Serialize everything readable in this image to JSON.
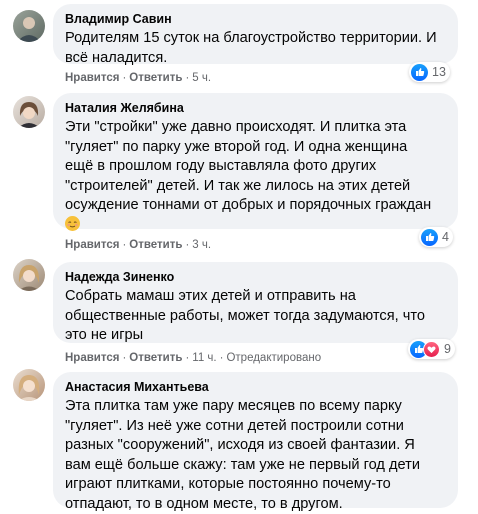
{
  "comments": [
    {
      "author": "Владимир Савин",
      "lines": [
        "Родителям 15 суток на благоустройство территории. И",
        "всё наладится."
      ],
      "like": "Нравится",
      "reply": "Ответить",
      "time": "5 ч.",
      "reaction_count": "13"
    },
    {
      "author": "Наталия Желябина",
      "lines": [
        "Эти \"стройки\" уже давно происходят. И плитка эта",
        "\"гуляет\" по парку уже второй год. И одна женщина",
        "ещё в прошлом году выставляла фото других",
        "\"строителей\" детей. И так же лилось на этих детей",
        "осуждение тоннами от добрых и порядочных граждан"
      ],
      "emoji": "relieved-face",
      "like": "Нравится",
      "reply": "Ответить",
      "time": "3 ч.",
      "reaction_count": "4"
    },
    {
      "author": "Надежда Зиненко",
      "lines": [
        "Собрать мамаш этих детей и отправить на",
        "общественные работы, может тогда задумаются, что",
        "это не игры"
      ],
      "like": "Нравится",
      "reply": "Ответить",
      "time": "11 ч.",
      "edited": "Отредактировано",
      "reaction_count": "9"
    },
    {
      "author": "Анастасия Михантьева",
      "lines": [
        "Эта плитка там уже пару месяцев по всему парку",
        "\"гуляет\". Из неё уже сотни детей построили сотни",
        "разных \"сооружений\", исходя из своей фантазии. Я",
        "вам ещё больше скажу: там уже не первый год дети",
        "играют плитками, которые постоянно почему-то",
        "отпадают, то в одном месте, то в другом."
      ]
    }
  ],
  "separator": "·",
  "colors": {
    "like_blue": "#0866ff",
    "love_red": "#e61e4d",
    "bubble": "#f0f2f5",
    "meta": "#65676b"
  },
  "icons": {
    "like": "thumbs-up-icon",
    "love": "heart-icon"
  }
}
